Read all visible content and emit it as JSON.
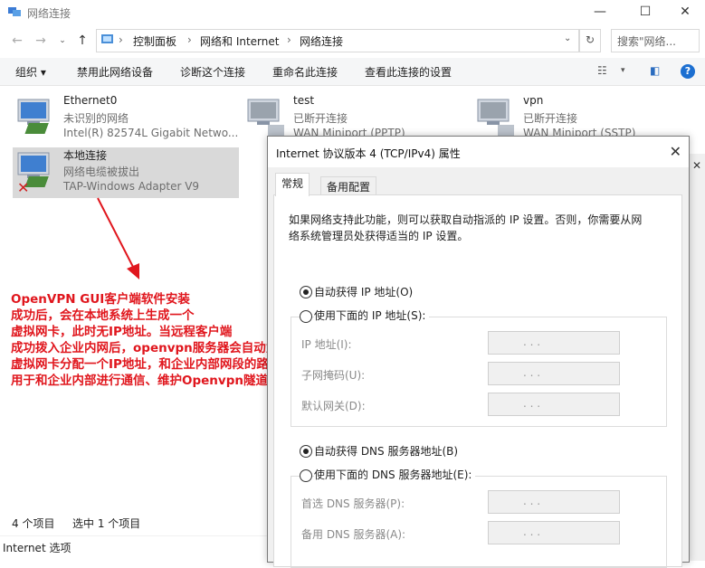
{
  "window": {
    "title": "网络连接"
  },
  "address": {
    "crumbs": [
      "控制面板",
      "网络和 Internet",
      "网络连接"
    ],
    "search_placeholder": "搜索\"网络..."
  },
  "commands": [
    "组织",
    "禁用此网络设备",
    "诊断这个连接",
    "重命名此连接",
    "查看此连接的设置"
  ],
  "items": [
    {
      "name": "Ethernet0",
      "status": "未识别的网络",
      "device": "Intel(R) 82574L Gigabit Netwo..."
    },
    {
      "name": "test",
      "status": "已断开连接",
      "device": "WAN Miniport (PPTP)"
    },
    {
      "name": "vpn",
      "status": "已断开连接",
      "device": "WAN Miniport (SSTP)"
    },
    {
      "name": "本地连接",
      "status": "网络电缆被拔出",
      "device": "TAP-Windows Adapter V9"
    }
  ],
  "annotation": [
    "OpenVPN GUI客户端软件安装",
    "成功后，会在本地系统上生成一个",
    "虚拟网卡，此时无IP地址。当远程客户端",
    "成功拨入企业内网后，openvpn服务器会自动为其",
    "虚拟网卡分配一个IP地址，和企业内部网段的路由，",
    "用于和企业内部进行通信、维护Openvpn隧道的连接。"
  ],
  "status": {
    "count": "4 个项目",
    "selected": "选中 1 个项目",
    "footer": "Internet 选项"
  },
  "dialog": {
    "title": "Internet 协议版本 4 (TCP/IPv4) 属性",
    "tabs": [
      "常规",
      "备用配置"
    ],
    "intro_line1": "如果网络支持此功能，则可以获取自动指派的 IP 设置。否则，你需要从网",
    "intro_line2": "络系统管理员处获得适当的 IP 设置。",
    "auto_ip": "自动获得 IP 地址(O)",
    "manual_ip": "使用下面的 IP 地址(S):",
    "ip_label": "IP 地址(I):",
    "mask_label": "子网掩码(U):",
    "gateway_label": "默认网关(D):",
    "auto_dns": "自动获得 DNS 服务器地址(B)",
    "manual_dns": "使用下面的 DNS 服务器地址(E):",
    "dns1_label": "首选 DNS 服务器(P):",
    "dns2_label": "备用 DNS 服务器(A):",
    "ip_dots": ".     .     ."
  },
  "colors": {
    "annotation": "#e0161d",
    "selection": "#d9d9d9"
  }
}
